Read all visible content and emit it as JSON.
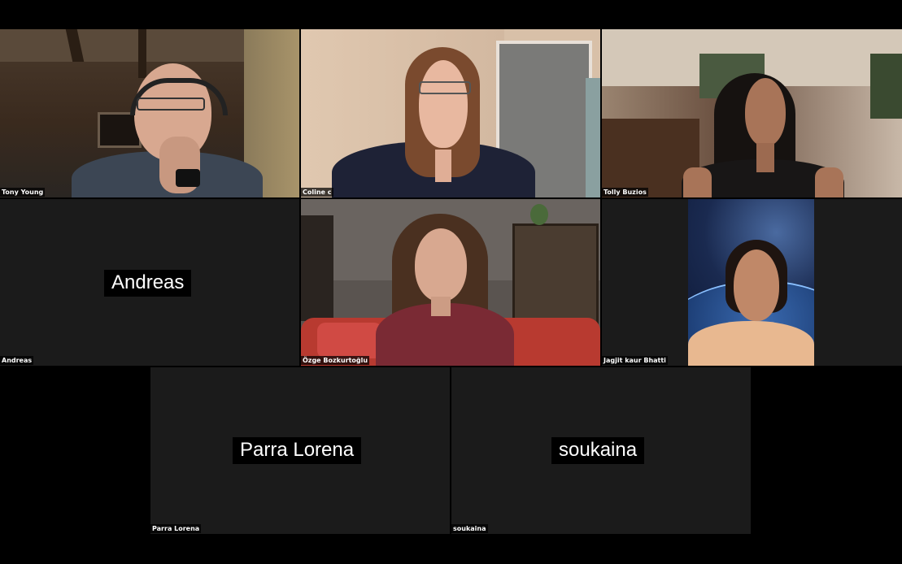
{
  "participants": [
    {
      "name": "Tony Young",
      "video": true
    },
    {
      "name": "Coline c",
      "video": true
    },
    {
      "name": "Tolly Buzios",
      "video": true
    },
    {
      "name": "Andreas",
      "video": false,
      "display_name": "Andreas"
    },
    {
      "name": "Özge Bozkurtoğlu",
      "video": true
    },
    {
      "name": "Jagjit kaur Bhatti",
      "video": true
    },
    {
      "name": "Parra Lorena",
      "video": false,
      "display_name": "Parra Lorena"
    },
    {
      "name": "soukaina",
      "video": false,
      "display_name": "soukaina"
    }
  ],
  "colors": {
    "background": "#000000",
    "empty_tile": "#1b1b1b",
    "name_text": "#ffffff"
  }
}
